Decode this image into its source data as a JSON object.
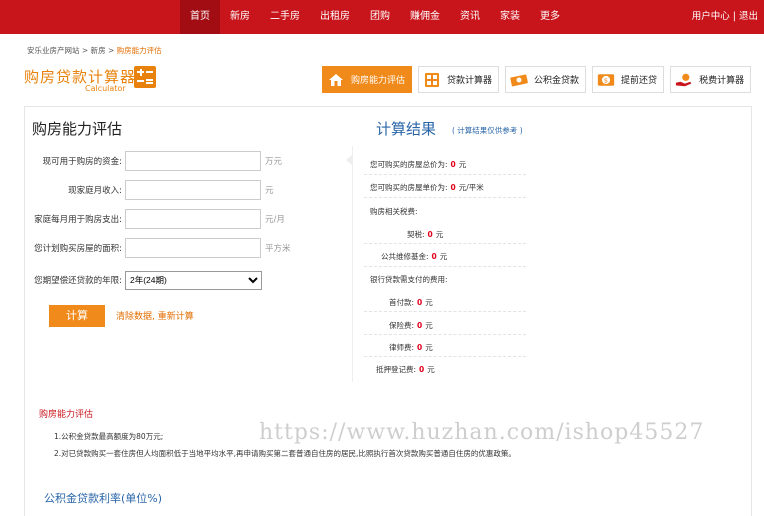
{
  "nav": {
    "items": [
      "首页",
      "新房",
      "二手房",
      "出租房",
      "团购",
      "赚佣金",
      "资讯",
      "家装",
      "更多"
    ],
    "user_center": "用户中心",
    "separator": "|",
    "logout": "退出"
  },
  "breadcrumb": {
    "site": "安乐业房产网站",
    "sep": ">",
    "section": "新房",
    "current": "购房能力评估"
  },
  "logo": {
    "title": "购房贷款计算器",
    "subtitle": "Calculator"
  },
  "tabs": [
    {
      "label": "购房能力评估",
      "icon": "house-icon"
    },
    {
      "label": "贷款计算器",
      "icon": "calculator-icon"
    },
    {
      "label": "公积金贷款",
      "icon": "cash-icon"
    },
    {
      "label": "提前还贷",
      "icon": "coin-icon"
    },
    {
      "label": "税费计算器",
      "icon": "hand-money-icon"
    }
  ],
  "form": {
    "title": "购房能力评估",
    "rows": [
      {
        "label": "现可用于购房的资金:",
        "value": "",
        "unit": "万元"
      },
      {
        "label": "现家庭月收入:",
        "value": "",
        "unit": "元"
      },
      {
        "label": "家庭每月用于购房支出:",
        "value": "",
        "unit": "元/月"
      },
      {
        "label": "您计划购买房屋的面积:",
        "value": "",
        "unit": "平方米"
      }
    ],
    "years_label": "您期望偿还贷款的年限:",
    "years_value": "2年(24期)",
    "calc_button": "计算",
    "clear_link": "清除数据, 重新计算"
  },
  "result": {
    "title": "计算结果",
    "note": "( 计算结果仅供参考 )",
    "total_label": "您可购买的房屋总价为:",
    "total_value": "0",
    "total_unit": "元",
    "unit_price_label": "您可购买的房屋单价为:",
    "unit_price_value": "0",
    "unit_price_unit": "元/平米",
    "tax_header": "购房相关税费:",
    "deed_tax_label": "契税:",
    "deed_tax_value": "0",
    "deed_tax_unit": "元",
    "maintenance_label": "公共维修基金:",
    "maintenance_value": "0",
    "maintenance_unit": "元",
    "loan_header": "银行贷款需支付的费用:",
    "down_label": "首付款:",
    "down_value": "0",
    "down_unit": "元",
    "insurance_label": "保险费:",
    "insurance_value": "0",
    "insurance_unit": "元",
    "lawyer_label": "律师费:",
    "lawyer_value": "0",
    "lawyer_unit": "元",
    "mortgage_label": "抵押登记费:",
    "mortgage_value": "0",
    "mortgage_unit": "元"
  },
  "notes": {
    "title": "购房能力评估",
    "line1": "1.公积金贷款最高额度为80万元;",
    "line2": "2.对已贷款购买一套住房但人均面积低于当地平均水平,再申请购买第二套普通自住房的居民,比照执行首次贷款购买普通自住房的优惠政策。"
  },
  "rate_title": "公积金贷款利率(单位%)",
  "watermark": "https://www.huzhan.com/ishop45527",
  "colors": {
    "brand_red": "#c8141b",
    "accent_orange": "#f08a1a",
    "title_blue": "#2a66a8"
  }
}
